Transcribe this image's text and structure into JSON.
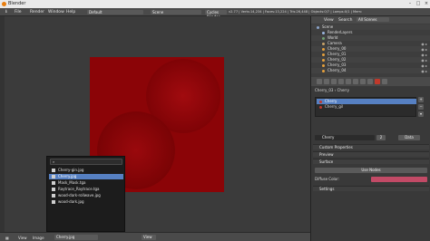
{
  "window": {
    "title": "Blender"
  },
  "info_header": {
    "menus": [
      "File",
      "Render",
      "Window",
      "Help"
    ],
    "layout": "Default",
    "scene": "Scene",
    "engine": "Cycles Render",
    "stats": "v2.77 | Verts:14,234 | Faces:13,224 | Tris:26,448 | Objects:0/7 | Lamps:0/1 | Mem:"
  },
  "file_browser": {
    "search_value": "",
    "items": [
      {
        "label": "Cherry-gin.jpg",
        "selected": false
      },
      {
        "label": "Cherry.jpg",
        "selected": true
      },
      {
        "label": "Mask_Mask.tga",
        "selected": false
      },
      {
        "label": "Raytrace_Raytrace.tga",
        "selected": false
      },
      {
        "label": "wood-dark-rollwave.jpg",
        "selected": false
      },
      {
        "label": "wood-dark.jpg",
        "selected": false
      }
    ]
  },
  "bottom_bar": {
    "items": [
      "View",
      "Image"
    ],
    "image_field": "Cherry.jpg",
    "view_label": "View"
  },
  "outliner": {
    "header": {
      "view": "View",
      "search": "Search",
      "filter": "All Scenes"
    },
    "rows": [
      {
        "label": "Scene",
        "color": "#8aa2c8"
      },
      {
        "label": "RenderLayers",
        "color": "#9bb6de"
      },
      {
        "label": "World",
        "color": "#6f9f6f"
      },
      {
        "label": "Camera",
        "color": "#c8a36a"
      },
      {
        "label": "Cherry_00",
        "color": "#e6a03c"
      },
      {
        "label": "Cherry_01",
        "color": "#e6a03c"
      },
      {
        "label": "Cherry_02",
        "color": "#e6a03c"
      },
      {
        "label": "Cherry_03",
        "color": "#e6a03c"
      },
      {
        "label": "Cherry_04",
        "color": "#e6a03c"
      }
    ]
  },
  "properties": {
    "breadcrumb": [
      "Cherry_03",
      "Cherry"
    ],
    "materials": [
      {
        "label": "Cherry",
        "selected": true
      },
      {
        "label": "Cherry_gil",
        "selected": false
      }
    ],
    "material_field": "Cherry",
    "material_users": "2",
    "data_label": "Data",
    "panels": [
      "Custom Properties",
      "Preview",
      "Surface",
      "Settings"
    ],
    "use_nodes_label": "Use Nodes",
    "diffuse_color_label": "Diffuse Color:",
    "diffuse_color": "#c24a66"
  },
  "colors": {
    "image_red": "#8b0407",
    "selection": "#5680c2"
  }
}
